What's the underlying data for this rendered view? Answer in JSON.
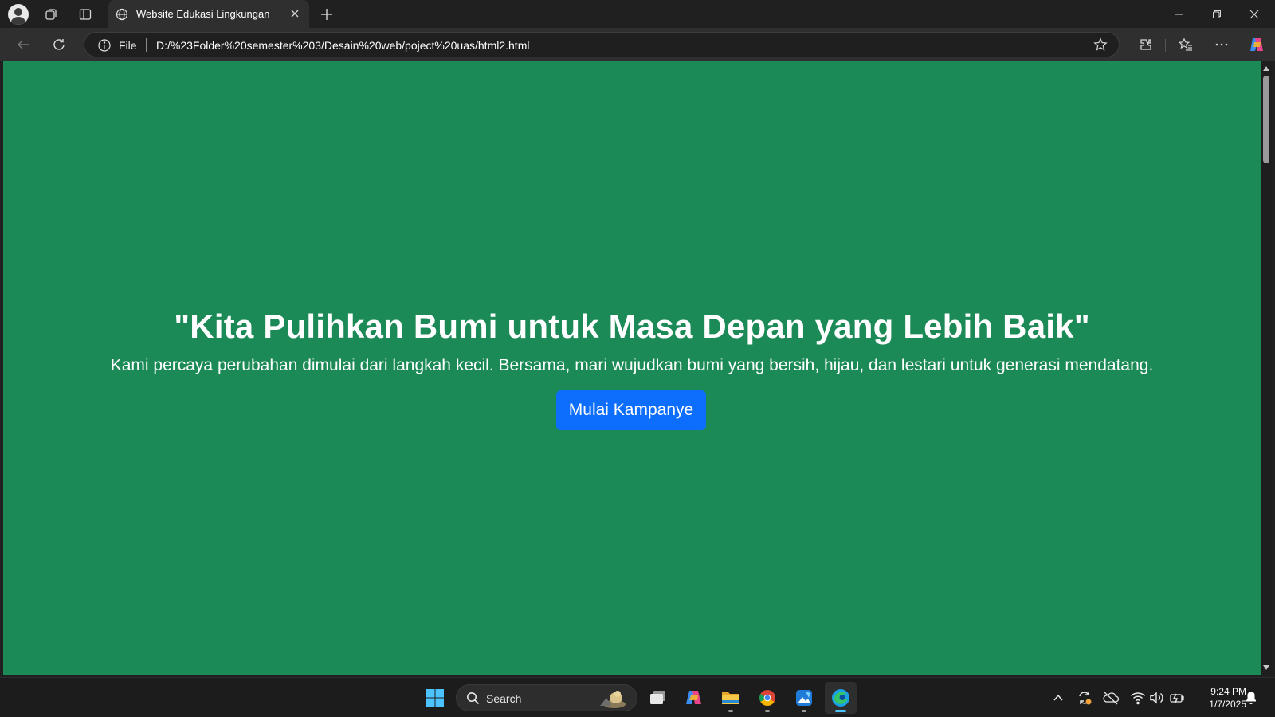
{
  "browser": {
    "tab": {
      "title": "Website Edukasi Lingkungan"
    },
    "address_bar": {
      "scheme_label": "File",
      "url": "D:/%23Folder%20semester%203/Desain%20web/poject%20uas/html2.html"
    }
  },
  "page": {
    "background_color": "#1b8a57",
    "hero": {
      "headline": "\"Kita Pulihkan Bumi untuk Masa Depan yang Lebih Baik\"",
      "subtext": "Kami percaya perubahan dimulai dari langkah kecil. Bersama, mari wujudkan bumi yang bersih, hijau, dan lestari untuk generasi mendatang.",
      "cta_label": "Mulai Kampanye",
      "cta_color": "#0d6efd"
    }
  },
  "taskbar": {
    "search_placeholder": "Search",
    "apps": [
      "windows-start-icon",
      "task-view-icon",
      "copilot-icon",
      "file-explorer-icon",
      "chrome-icon",
      "photos-icon",
      "edge-icon"
    ],
    "clock": {
      "time": "9:24 PM",
      "date": "1/7/2025"
    }
  }
}
